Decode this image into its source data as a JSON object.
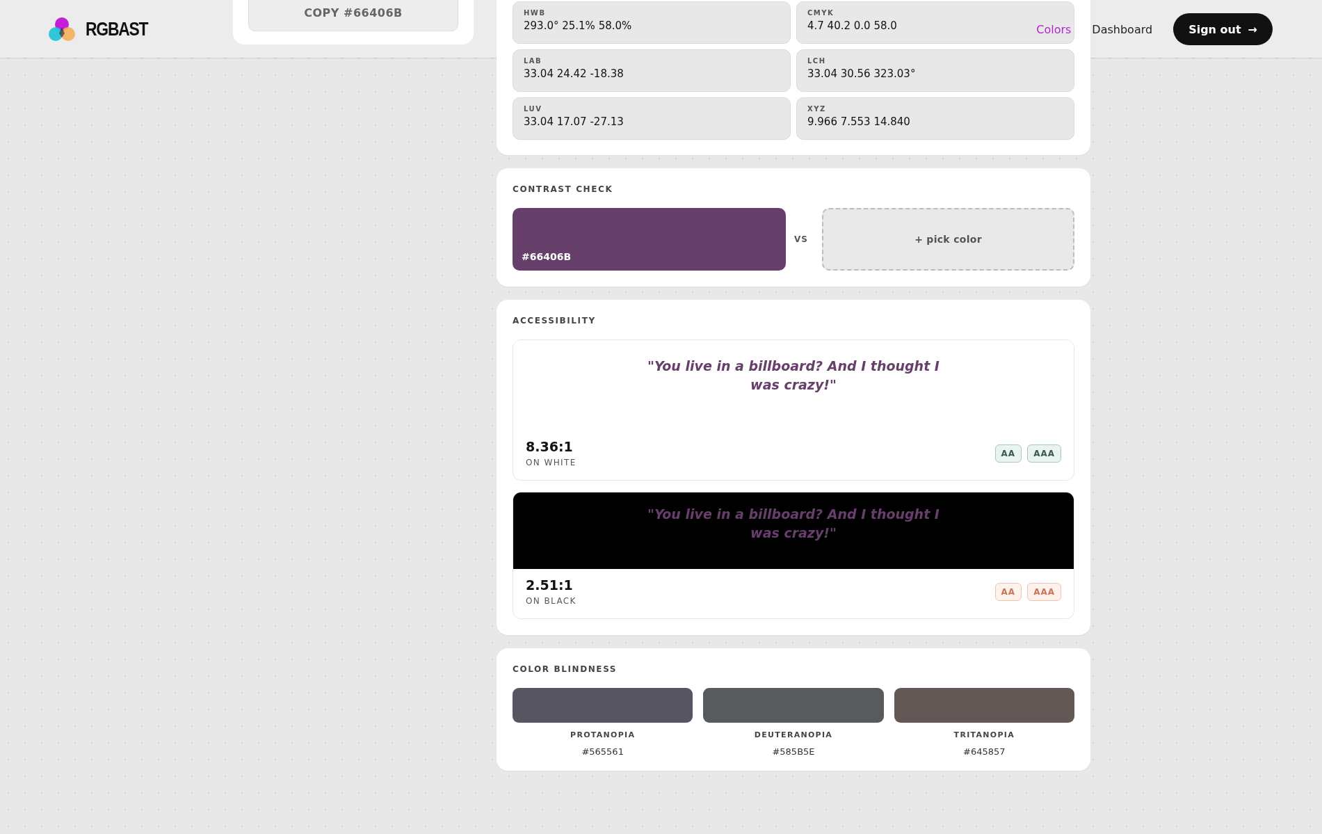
{
  "header": {
    "logo": "RGBAST",
    "nav": [
      {
        "label": "Colors",
        "selected": true
      },
      {
        "label": "Dashboard",
        "selected": false
      }
    ],
    "sign_out": "Sign out",
    "sign_out_arrow": "→"
  },
  "copy_button": "COPY #66406B",
  "formats": [
    {
      "label": "HWB",
      "value": "293.0° 25.1% 58.0%"
    },
    {
      "label": "CMYK",
      "value": "4.7 40.2 0.0 58.0"
    },
    {
      "label": "LAB",
      "value": "33.04 24.42 -18.38"
    },
    {
      "label": "LCH",
      "value": "33.04 30.56 323.03°"
    },
    {
      "label": "LUV",
      "value": "33.04 17.07 -27.13"
    },
    {
      "label": "XYZ",
      "value": "9.966 7.553 14.840"
    }
  ],
  "contrast": {
    "title": "CONTRAST CHECK",
    "swatch": {
      "hex": "#66406B",
      "color": "#66406b"
    },
    "vs": "VS",
    "pick": "+ pick color"
  },
  "accessibility": {
    "title": "ACCESSIBILITY",
    "cards": [
      {
        "kind": "white",
        "quote": "\"You live in a billboard? And I thought I was crazy!\"",
        "ratio": "8.36:1",
        "caption": "ON WHITE",
        "badges": [
          {
            "label": "AA",
            "pass": true
          },
          {
            "label": "AAA",
            "pass": true
          }
        ]
      },
      {
        "kind": "black",
        "quote": "\"You live in a billboard? And I thought I was crazy!\"",
        "ratio": "2.51:1",
        "caption": "ON BLACK",
        "badges": [
          {
            "label": "AA",
            "pass": false
          },
          {
            "label": "AAA",
            "pass": false
          }
        ]
      }
    ]
  },
  "color_blindness": {
    "title": "COLOR BLINDNESS",
    "items": [
      {
        "name": "PROTANOPIA",
        "hex": "#565561",
        "color": "#565561"
      },
      {
        "name": "DEUTERANOPIA",
        "hex": "#585B5E",
        "color": "#585b5e"
      },
      {
        "name": "TRITANOPIA",
        "hex": "#645857",
        "color": "#645857"
      }
    ]
  }
}
